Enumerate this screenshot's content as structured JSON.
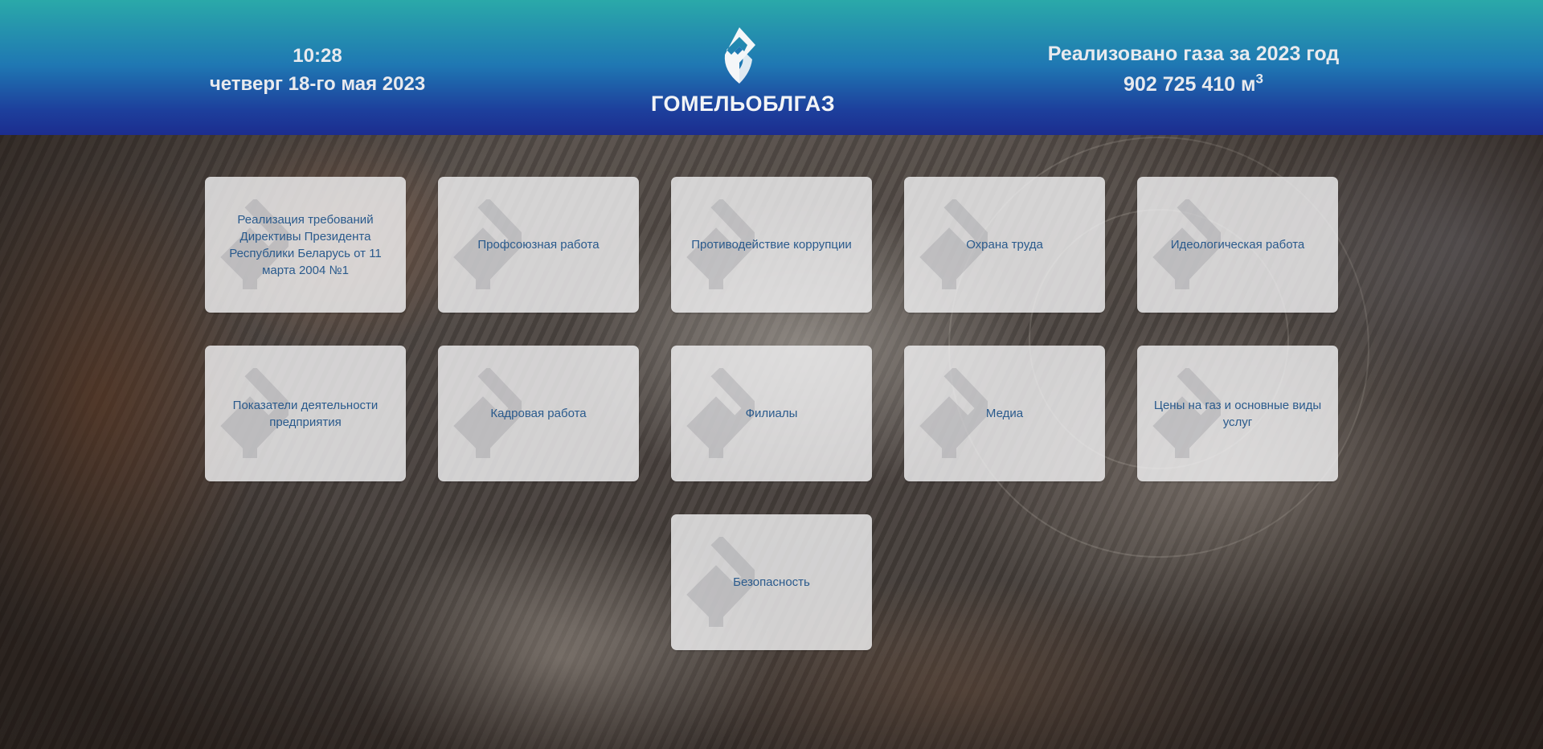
{
  "header": {
    "time": "10:28",
    "date": "четверг 18-го мая 2023",
    "logo_text": "ГОМЕЛЬОБЛГАЗ",
    "gas_title": "Реализовано газа за 2023 год",
    "gas_value": "902 725 410 м",
    "gas_unit_sup": "3"
  },
  "tiles": [
    {
      "label": "Реализация требований Директивы Президента Республики Беларусь от 11 марта 2004 №1"
    },
    {
      "label": "Профсоюзная работа"
    },
    {
      "label": "Противодействие коррупции"
    },
    {
      "label": "Охрана труда"
    },
    {
      "label": "Идеологическая работа"
    },
    {
      "label": "Показатели деятельности предприятия"
    },
    {
      "label": "Кадровая работа"
    },
    {
      "label": "Филиалы"
    },
    {
      "label": "Медиа"
    },
    {
      "label": "Цены на газ и основные виды услуг"
    },
    {
      "label": "Безопасность"
    }
  ],
  "colors": {
    "header_top": "#2aa9a9",
    "header_bottom": "#1c2d8f",
    "tile_text": "#2a5a8c",
    "tile_bg": "#f0f0f2"
  },
  "icons": {
    "logo": "gas-flame-logo-icon",
    "tile_watermark": "gas-flame-watermark-icon"
  }
}
